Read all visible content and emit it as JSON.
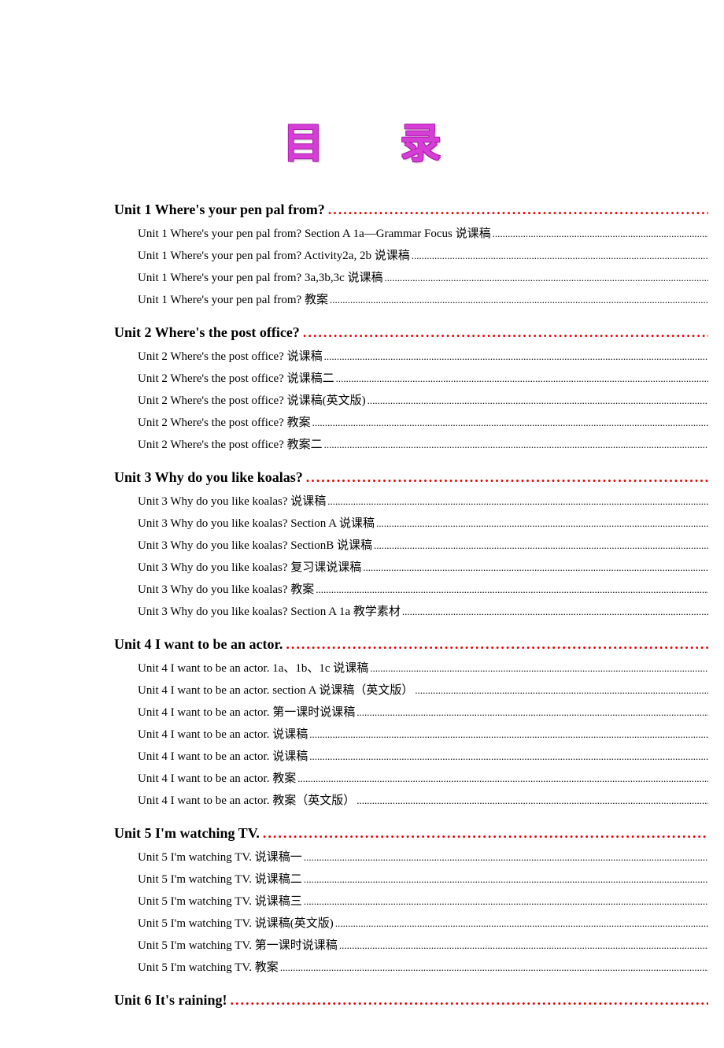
{
  "title": "目 录",
  "sections": [
    {
      "heading": "Unit 1 Where's your pen pal from? ",
      "entries": [
        "Unit 1 Where's your pen pal from? Section A 1a—Grammar Focus 说课稿",
        "Unit 1 Where's your pen pal from? Activity2a, 2b 说课稿 ",
        "Unit 1 Where's your pen pal from? 3a,3b,3c 说课稿",
        "Unit 1 Where's your pen pal from? 教案 "
      ]
    },
    {
      "heading": "Unit 2 Where's the post office? ",
      "entries": [
        "Unit 2 Where's the post office? 说课稿 ",
        "Unit 2 Where's the post office? 说课稿二 ",
        "Unit 2 Where's the post office? 说课稿(英文版)",
        "Unit 2 Where's the post office? 教案 ",
        "Unit 2 Where's the post office? 教案二 "
      ]
    },
    {
      "heading": "Unit 3 Why do you like koalas? ",
      "entries": [
        "Unit 3 Why do you like koalas? 说课稿",
        "Unit 3 Why do you like koalas? Section A 说课稿",
        "Unit 3 Why do you like koalas? SectionB 说课稿",
        "Unit 3 Why do you like koalas? 复习课说课稿",
        "Unit 3 Why do you like koalas? 教案",
        "Unit 3 Why do you like koalas? Section A 1a 教学素材 "
      ]
    },
    {
      "heading": "Unit 4 I want to be an actor. ",
      "entries": [
        "Unit 4 I want to be an actor. 1a、1b、1c 说课稿",
        "Unit 4 I want to be an actor. section A 说课稿（英文版） ",
        "Unit 4 I want to be an actor. 第一课时说课稿",
        "Unit 4 I want to be an actor. 说课稿",
        "Unit 4 I want to be an actor. 说课稿",
        "Unit 4 I want to be an actor. 教案 ",
        "Unit 4 I want to be an actor. 教案（英文版） "
      ]
    },
    {
      "heading": "Unit 5 I'm watching TV. ",
      "entries": [
        "Unit 5 I'm watching TV. 说课稿一",
        "Unit 5 I'm watching TV. 说课稿二",
        "Unit 5 I'm watching TV. 说课稿三 ",
        "Unit 5 I'm watching TV. 说课稿(英文版)",
        "Unit 5 I'm watching TV. 第一课时说课稿",
        "Unit 5 I'm watching TV. 教案"
      ]
    },
    {
      "heading": "Unit 6 It's raining! ",
      "entries": []
    }
  ]
}
